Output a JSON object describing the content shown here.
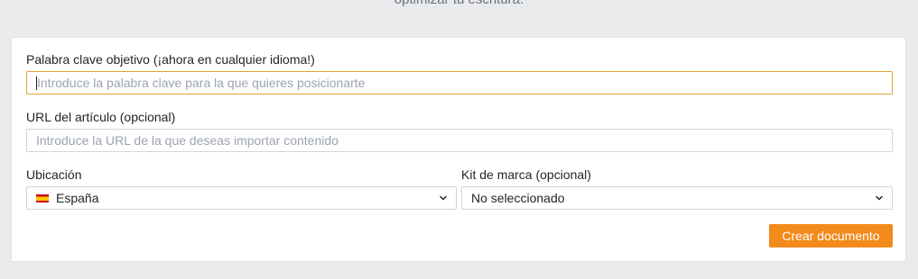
{
  "header": {
    "partial_text": "optimizar tu escritura."
  },
  "form": {
    "keyword": {
      "label": "Palabra clave objetivo (¡ahora en cualquier idioma!)",
      "placeholder": "Introduce la palabra clave para la que quieres posicionarte",
      "value": ""
    },
    "url": {
      "label": "URL del artículo (opcional)",
      "placeholder": "Introduce la URL de la que deseas importar contenido",
      "value": ""
    },
    "location": {
      "label": "Ubicación",
      "selected": "España",
      "flag_icon": "spain-flag-icon"
    },
    "brand_kit": {
      "label": "Kit de marca (opcional)",
      "selected": "No seleccionado"
    },
    "submit_label": "Crear documento"
  },
  "colors": {
    "accent": "#f28a1c",
    "focus_border": "#e0a437",
    "page_bg": "#e9eaec"
  }
}
